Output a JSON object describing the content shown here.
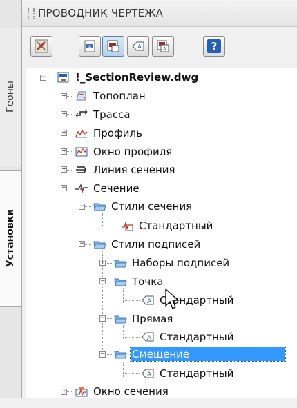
{
  "panel": {
    "title": "ПРОВОДНИК ЧЕРТЕЖА",
    "side_tabs": [
      "Геоны",
      "Установки"
    ]
  },
  "toolbar": {
    "buttons": [
      {
        "icon": "edit-settings-icon"
      },
      {
        "icon": "label-style-icon"
      },
      {
        "icon": "view-icon",
        "active": true
      },
      {
        "icon": "label-icon"
      },
      {
        "icon": "style-icon"
      },
      {
        "icon": "help-icon",
        "glyph": "?"
      }
    ]
  },
  "tree": {
    "root": "!_SectionReview.dwg",
    "items": {
      "topoplan": "Топоплан",
      "trassa": "Трасса",
      "profile": "Профиль",
      "profile_window": "Окно профиля",
      "section_line": "Линия сечения",
      "section": "Сечение",
      "section_styles": "Стили сечения",
      "section_style_std": "Стандартный",
      "label_styles": "Стили подписей",
      "label_sets": "Наборы подписей",
      "point": "Точка",
      "point_std": "Стандартный",
      "line": "Прямая",
      "line_std": "Стандартный",
      "offset": "Смещение",
      "offset_std": "Стандартный",
      "section_window": "Окно сечения"
    },
    "selected": "offset"
  },
  "colors": {
    "selection": "#3399ff",
    "folder": "#7fb3e6",
    "accent": "#2461b4"
  }
}
